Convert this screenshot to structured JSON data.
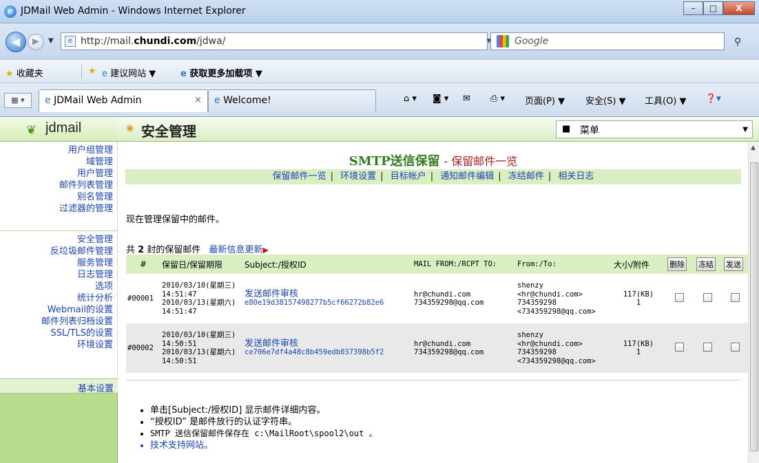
{
  "window": {
    "title": "JDMail Web Admin - Windows Internet Explorer",
    "minimize": "–",
    "maximize": "□",
    "close": "X"
  },
  "address_bar": {
    "url_prefix": "http://mail.",
    "url_domain": "chundi.com",
    "url_suffix": "/jdwa/",
    "search_placeholder": "Google"
  },
  "favorites_bar": {
    "favorites": "收藏夹",
    "suggested_sites": "建议网站 ▼",
    "get_addons": "获取更多加载项 ▼"
  },
  "tabs": [
    {
      "label": "JDMail Web Admin",
      "close": "×"
    },
    {
      "label": "Welcome!"
    }
  ],
  "command_bar": {
    "page": "页面(P) ▼",
    "safety": "安全(S) ▼",
    "tools": "工具(O) ▼"
  },
  "app": {
    "logo_text": "jdmail",
    "section_title": "安全管理",
    "menu_select": "菜单"
  },
  "sidebar": {
    "group1": [
      "用户组管理",
      "域管理",
      "用户管理",
      "邮件列表管理",
      "别名管理",
      "过滤器的管理"
    ],
    "group2": [
      "安全管理",
      "反垃圾邮件管理",
      "服务管理",
      "日志管理",
      "选项",
      "统计分析",
      "Webmail的设置",
      "邮件列表归档设置",
      "SSL/TLS的设置",
      "环境设置"
    ],
    "basic_settings": "基本设置"
  },
  "page": {
    "title_main": "SMTP送信保留",
    "title_sub": "保留邮件一览",
    "subnav": [
      "保留邮件一览",
      "环境设置",
      "目标帐户",
      "通知邮件编辑",
      "冻结邮件",
      "相关日志"
    ],
    "intro": "现在管理保留中的邮件。",
    "count_prefix": "共",
    "count": "2",
    "count_suffix": "封的保留邮件",
    "refresh": "最新信息更新"
  },
  "table": {
    "headers": {
      "num": "#",
      "dates": "保留日/保留期限",
      "subject": "Subject:/授权ID",
      "mailfrom": "MAIL FROM:/RCPT TO:",
      "fromto": "From:/To:",
      "size": "大小/附件",
      "delete": "删除",
      "freeze": "冻结",
      "send": "发送"
    },
    "rows": [
      {
        "id": "#00001",
        "date1": "2010/03/10(星期三) 14:51:47",
        "date2": "2010/03/13(星期六) 14:51:47",
        "subject": "发送邮件审核",
        "auth_id": "e80e19d38157498277b5cf66272b82e6",
        "mail_from": "hr@chundi.com",
        "rcpt_to": "734359298@qq.com",
        "from_name": "shenzy",
        "from_addr": "<hr@chundi.com>",
        "to_name": "734359298",
        "to_addr": "<734359298@qq.com>",
        "size": "117(KB)",
        "attachments": "1"
      },
      {
        "id": "#00002",
        "date1": "2010/03/10(星期三) 14:50:51",
        "date2": "2010/03/13(星期六) 14:50:51",
        "subject": "发送邮件审核",
        "auth_id": "ce706e7df4a48c8b459edb037398b5f2",
        "mail_from": "hr@chundi.com",
        "rcpt_to": "734359298@qq.com",
        "from_name": "shenzy",
        "from_addr": "<hr@chundi.com>",
        "to_name": "734359298",
        "to_addr": "<734359298@qq.com>",
        "size": "117(KB)",
        "attachments": "1"
      }
    ]
  },
  "notes": {
    "n1": "单击[Subject:/授权ID] 显示邮件详细内容。",
    "n2": "“授权ID” 是邮件放行的认证字符串。",
    "n3": "SMTP 送信保留邮件保存在 c:\\MailRoot\\spool2\\out 。",
    "n4": "技术支持网站。"
  }
}
